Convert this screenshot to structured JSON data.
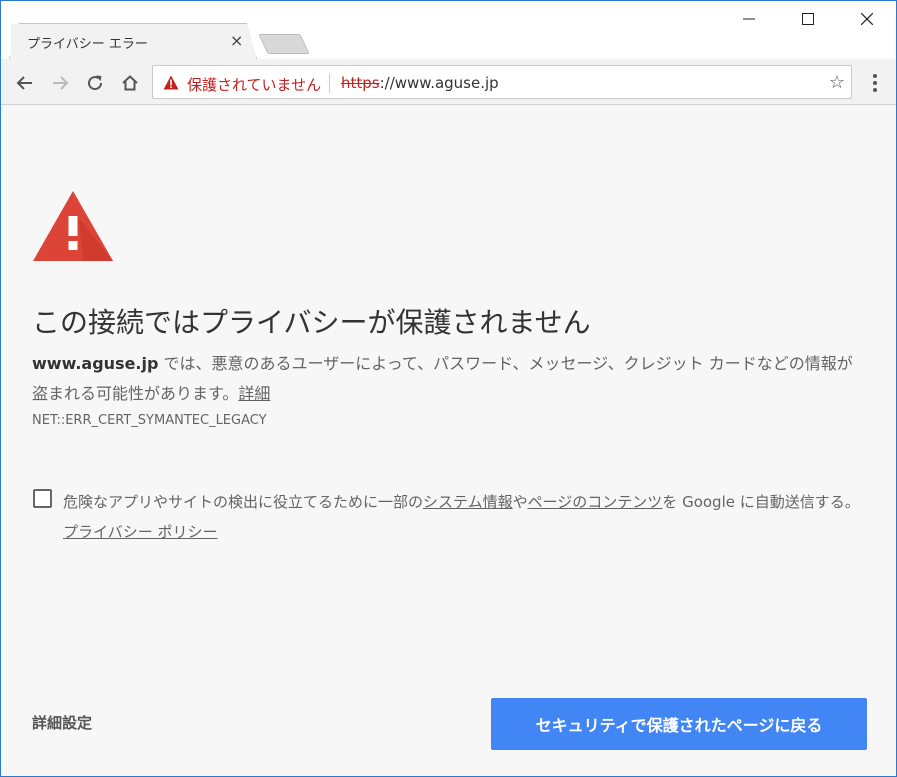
{
  "window": {
    "controls": {
      "minimize": "—",
      "maximize": "☐",
      "close": "✕"
    }
  },
  "tab": {
    "title": "プライバシー エラー",
    "close_glyph": "×"
  },
  "omnibox": {
    "status": "保護されていません",
    "url_scheme": "https",
    "url_rest": "://www.aguse.jp",
    "star_glyph": "☆"
  },
  "content": {
    "heading": "この接続ではプライバシーが保護されません",
    "explain_domain": "www.aguse.jp",
    "explain_text": " では、悪意のあるユーザーによって、パスワード、メッセージ、クレジット カードなどの情報が盗まれる可能性があります。",
    "details_link": "詳細",
    "error_code": "NET::ERR_CERT_SYMANTEC_LEGACY",
    "checkbox_checked": false,
    "cb_text_1": "危険なアプリやサイトの検出に役立てるために一部の",
    "cb_link_1": "システム情報",
    "cb_text_2": "や",
    "cb_link_2": "ページのコンテンツ",
    "cb_text_3": "を Google に自動送信する。",
    "cb_link_3": "プライバシー ポリシー",
    "advanced": "詳細設定",
    "back_button": "セキュリティで保護されたページに戻る"
  },
  "colors": {
    "accent": "#4285f4",
    "warning": "#db4437",
    "insecure_text": "#c5221f",
    "window_border": "#2b79d4"
  }
}
